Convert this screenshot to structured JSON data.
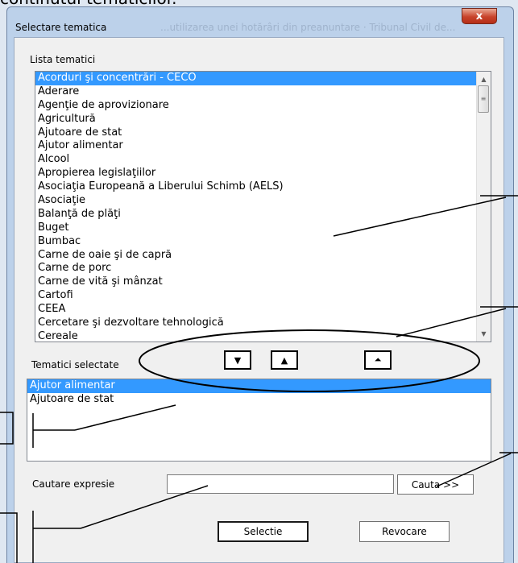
{
  "document": {
    "text_above": "continutul tematicilor."
  },
  "window": {
    "title": "Selectare tematica",
    "background_title": "...utilizarea unei hotărâri din preanuntare · Tribunal Civil de...",
    "close_symbol": "x"
  },
  "themes_list": {
    "label": "Lista tematici",
    "items": [
      "Acorduri şi concentrări - CECO",
      "Aderare",
      "Agenţie de aprovizionare",
      "Agricultură",
      "Ajutoare de stat",
      "Ajutor alimentar",
      "Alcool",
      "Apropierea legislaţiilor",
      "Asociaţia Europeană a Liberului Schimb (AELS)",
      "Asociaţie",
      "Balanţă de plăţi",
      "Buget",
      "Bumbac",
      "Carne de oaie şi de capră",
      "Carne de porc",
      "Carne de vită şi mânzat",
      "Cartofi",
      "CEEA",
      "Cercetare şi dezvoltare tehnologică",
      "Cereale"
    ],
    "selected_index": 0
  },
  "move_buttons": {
    "down_symbol": "▼",
    "up_symbol": "▲",
    "up_all_symbol": "⏶"
  },
  "selected_list": {
    "label": "Tematici selectate",
    "items": [
      "Ajutor alimentar",
      "Ajutoare de stat"
    ],
    "selected_index": 0
  },
  "search": {
    "label": "Cautare expresie",
    "value": "",
    "button_label": "Cauta >>"
  },
  "footer": {
    "select_label": "Selectie",
    "cancel_label": "Revocare"
  },
  "colors": {
    "selection": "#3399ff",
    "client_bg": "#f0f0f0",
    "frame": "#bcd1ea",
    "close_button": "#c8432b"
  }
}
